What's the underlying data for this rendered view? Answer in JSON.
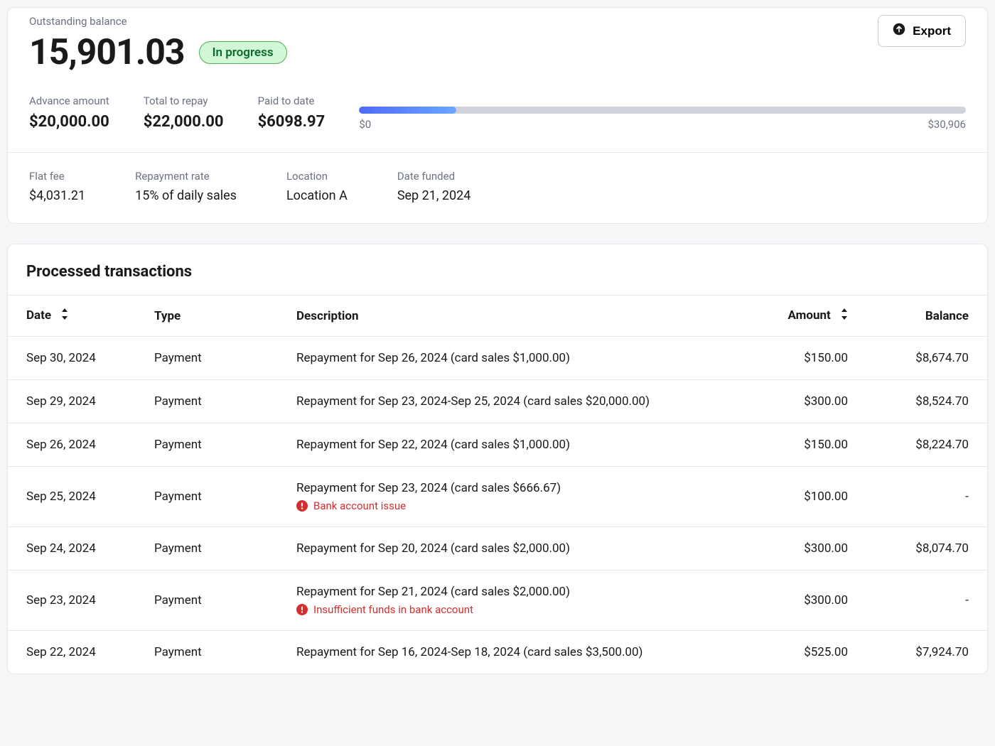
{
  "header": {
    "outstanding_label": "Outstanding balance",
    "balance": "15,901.03",
    "status": "In progress",
    "export_label": "Export"
  },
  "summary": {
    "advance_label": "Advance amount",
    "advance_value": "$20,000.00",
    "total_label": "Total to repay",
    "total_value": "$22,000.00",
    "paid_label": "Paid to date",
    "paid_value": "$6098.97"
  },
  "progress": {
    "min": "$0",
    "max": "$30,906",
    "percent": 16
  },
  "details": {
    "flat_fee_label": "Flat fee",
    "flat_fee_value": "$4,031.21",
    "rate_label": "Repayment rate",
    "rate_value": "15% of daily sales",
    "location_label": "Location",
    "location_value": "Location A",
    "funded_label": "Date funded",
    "funded_value": "Sep 21, 2024"
  },
  "transactions": {
    "title": "Processed transactions",
    "columns": {
      "date": "Date",
      "type": "Type",
      "description": "Description",
      "amount": "Amount",
      "balance": "Balance"
    },
    "rows": [
      {
        "date": "Sep 30, 2024",
        "type": "Payment",
        "description": "Repayment for Sep 26, 2024 (card sales $1,000.00)",
        "error": "",
        "amount": "$150.00",
        "balance": "$8,674.70"
      },
      {
        "date": "Sep 29, 2024",
        "type": "Payment",
        "description": "Repayment for Sep 23, 2024-Sep 25, 2024 (card sales $20,000.00)",
        "error": "",
        "amount": "$300.00",
        "balance": "$8,524.70"
      },
      {
        "date": "Sep 26, 2024",
        "type": "Payment",
        "description": "Repayment for Sep 22, 2024 (card sales $1,000.00)",
        "error": "",
        "amount": "$150.00",
        "balance": "$8,224.70"
      },
      {
        "date": "Sep 25, 2024",
        "type": "Payment",
        "description": "Repayment for Sep 23, 2024 (card sales $666.67)",
        "error": "Bank account issue",
        "amount": "$100.00",
        "balance": "-"
      },
      {
        "date": "Sep 24, 2024",
        "type": "Payment",
        "description": "Repayment for Sep 20, 2024 (card sales $2,000.00)",
        "error": "",
        "amount": "$300.00",
        "balance": "$8,074.70"
      },
      {
        "date": "Sep 23, 2024",
        "type": "Payment",
        "description": "Repayment for Sep 21, 2024 (card sales $2,000.00)",
        "error": "Insufficient funds in bank account",
        "amount": "$300.00",
        "balance": "-"
      },
      {
        "date": "Sep 22, 2024",
        "type": "Payment",
        "description": "Repayment for Sep 16, 2024-Sep 18, 2024 (card sales $3,500.00)",
        "error": "",
        "amount": "$525.00",
        "balance": "$7,924.70"
      }
    ]
  }
}
